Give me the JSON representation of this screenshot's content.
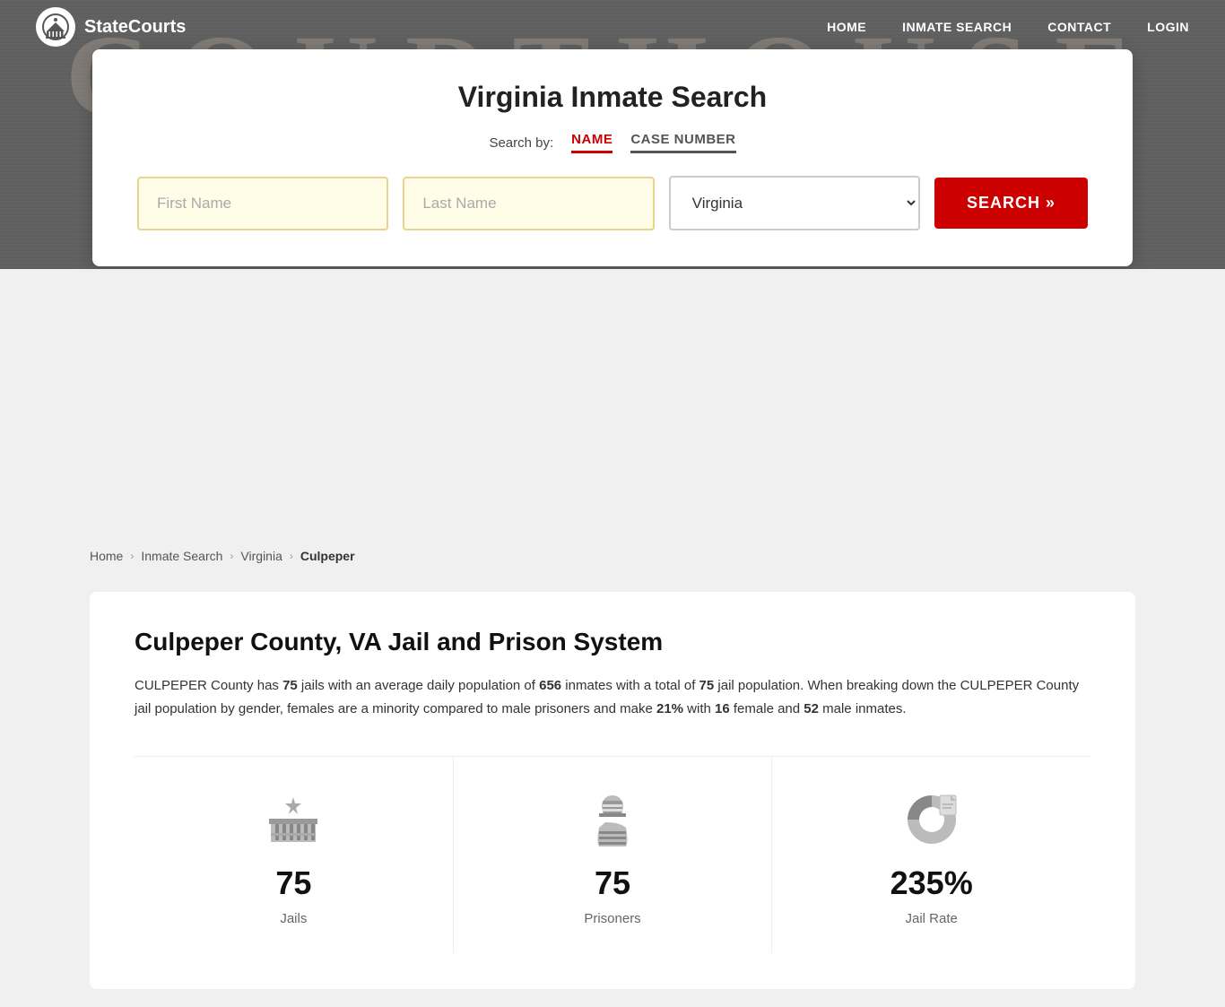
{
  "header": {
    "courthouse_text": "COURTHOUSE",
    "logo_symbol": "🏛",
    "logo_name": "StateCourts"
  },
  "nav": {
    "home": "HOME",
    "inmate_search": "INMATE SEARCH",
    "contact": "CONTACT",
    "login": "LOGIN"
  },
  "search_card": {
    "title": "Virginia Inmate Search",
    "search_by_label": "Search by:",
    "tab_name": "NAME",
    "tab_case": "CASE NUMBER",
    "first_name_placeholder": "First Name",
    "last_name_placeholder": "Last Name",
    "state_value": "Virginia",
    "search_button": "SEARCH »"
  },
  "breadcrumb": {
    "home": "Home",
    "inmate_search": "Inmate Search",
    "state": "Virginia",
    "current": "Culpeper"
  },
  "main": {
    "title": "Culpeper County, VA Jail and Prison System",
    "description_parts": {
      "intro": "CULPEPER County has ",
      "jails_count": "75",
      "mid1": " jails with an average daily population of ",
      "pop_count": "656",
      "mid2": " inmates with a total of ",
      "jail_pop": "75",
      "mid3": " jail population. When breaking down the CULPEPER County jail population by gender, females are a minority compared to male prisoners and make ",
      "female_pct": "21%",
      "mid4": " with ",
      "female_count": "16",
      "mid5": " female and ",
      "male_count": "52",
      "end": " male inmates."
    },
    "stats": [
      {
        "number": "75",
        "label": "Jails",
        "icon": "jail-icon"
      },
      {
        "number": "75",
        "label": "Prisoners",
        "icon": "prisoner-icon"
      },
      {
        "number": "235%",
        "label": "Jail Rate",
        "icon": "chart-icon"
      }
    ]
  },
  "colors": {
    "accent_red": "#cc0000",
    "input_bg": "#fffde7",
    "input_border": "#e8d48a"
  }
}
